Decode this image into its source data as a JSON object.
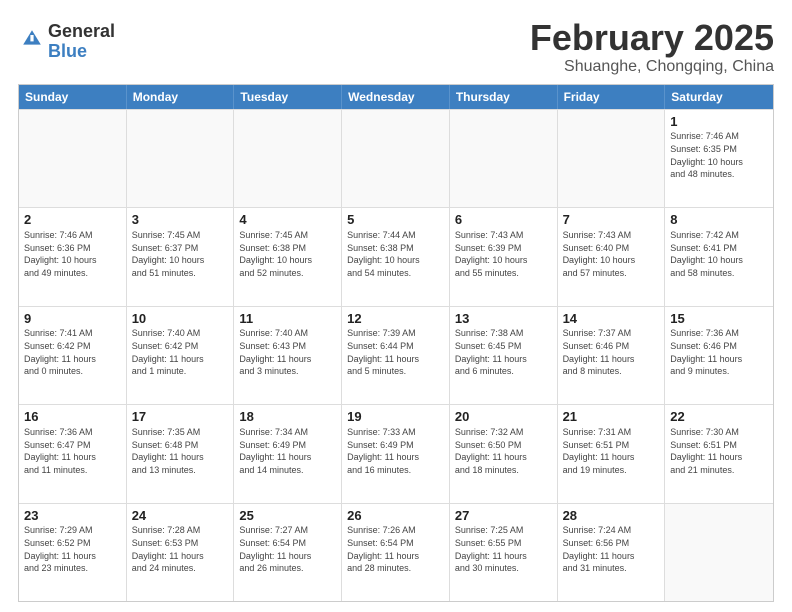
{
  "logo": {
    "general": "General",
    "blue": "Blue"
  },
  "header": {
    "month": "February 2025",
    "location": "Shuanghe, Chongqing, China"
  },
  "dayHeaders": [
    "Sunday",
    "Monday",
    "Tuesday",
    "Wednesday",
    "Thursday",
    "Friday",
    "Saturday"
  ],
  "weeks": [
    [
      {
        "day": "",
        "info": "",
        "empty": true
      },
      {
        "day": "",
        "info": "",
        "empty": true
      },
      {
        "day": "",
        "info": "",
        "empty": true
      },
      {
        "day": "",
        "info": "",
        "empty": true
      },
      {
        "day": "",
        "info": "",
        "empty": true
      },
      {
        "day": "",
        "info": "",
        "empty": true
      },
      {
        "day": "1",
        "info": "Sunrise: 7:46 AM\nSunset: 6:35 PM\nDaylight: 10 hours\nand 48 minutes.",
        "empty": false
      }
    ],
    [
      {
        "day": "2",
        "info": "Sunrise: 7:46 AM\nSunset: 6:36 PM\nDaylight: 10 hours\nand 49 minutes.",
        "empty": false
      },
      {
        "day": "3",
        "info": "Sunrise: 7:45 AM\nSunset: 6:37 PM\nDaylight: 10 hours\nand 51 minutes.",
        "empty": false
      },
      {
        "day": "4",
        "info": "Sunrise: 7:45 AM\nSunset: 6:38 PM\nDaylight: 10 hours\nand 52 minutes.",
        "empty": false
      },
      {
        "day": "5",
        "info": "Sunrise: 7:44 AM\nSunset: 6:38 PM\nDaylight: 10 hours\nand 54 minutes.",
        "empty": false
      },
      {
        "day": "6",
        "info": "Sunrise: 7:43 AM\nSunset: 6:39 PM\nDaylight: 10 hours\nand 55 minutes.",
        "empty": false
      },
      {
        "day": "7",
        "info": "Sunrise: 7:43 AM\nSunset: 6:40 PM\nDaylight: 10 hours\nand 57 minutes.",
        "empty": false
      },
      {
        "day": "8",
        "info": "Sunrise: 7:42 AM\nSunset: 6:41 PM\nDaylight: 10 hours\nand 58 minutes.",
        "empty": false
      }
    ],
    [
      {
        "day": "9",
        "info": "Sunrise: 7:41 AM\nSunset: 6:42 PM\nDaylight: 11 hours\nand 0 minutes.",
        "empty": false
      },
      {
        "day": "10",
        "info": "Sunrise: 7:40 AM\nSunset: 6:42 PM\nDaylight: 11 hours\nand 1 minute.",
        "empty": false
      },
      {
        "day": "11",
        "info": "Sunrise: 7:40 AM\nSunset: 6:43 PM\nDaylight: 11 hours\nand 3 minutes.",
        "empty": false
      },
      {
        "day": "12",
        "info": "Sunrise: 7:39 AM\nSunset: 6:44 PM\nDaylight: 11 hours\nand 5 minutes.",
        "empty": false
      },
      {
        "day": "13",
        "info": "Sunrise: 7:38 AM\nSunset: 6:45 PM\nDaylight: 11 hours\nand 6 minutes.",
        "empty": false
      },
      {
        "day": "14",
        "info": "Sunrise: 7:37 AM\nSunset: 6:46 PM\nDaylight: 11 hours\nand 8 minutes.",
        "empty": false
      },
      {
        "day": "15",
        "info": "Sunrise: 7:36 AM\nSunset: 6:46 PM\nDaylight: 11 hours\nand 9 minutes.",
        "empty": false
      }
    ],
    [
      {
        "day": "16",
        "info": "Sunrise: 7:36 AM\nSunset: 6:47 PM\nDaylight: 11 hours\nand 11 minutes.",
        "empty": false
      },
      {
        "day": "17",
        "info": "Sunrise: 7:35 AM\nSunset: 6:48 PM\nDaylight: 11 hours\nand 13 minutes.",
        "empty": false
      },
      {
        "day": "18",
        "info": "Sunrise: 7:34 AM\nSunset: 6:49 PM\nDaylight: 11 hours\nand 14 minutes.",
        "empty": false
      },
      {
        "day": "19",
        "info": "Sunrise: 7:33 AM\nSunset: 6:49 PM\nDaylight: 11 hours\nand 16 minutes.",
        "empty": false
      },
      {
        "day": "20",
        "info": "Sunrise: 7:32 AM\nSunset: 6:50 PM\nDaylight: 11 hours\nand 18 minutes.",
        "empty": false
      },
      {
        "day": "21",
        "info": "Sunrise: 7:31 AM\nSunset: 6:51 PM\nDaylight: 11 hours\nand 19 minutes.",
        "empty": false
      },
      {
        "day": "22",
        "info": "Sunrise: 7:30 AM\nSunset: 6:51 PM\nDaylight: 11 hours\nand 21 minutes.",
        "empty": false
      }
    ],
    [
      {
        "day": "23",
        "info": "Sunrise: 7:29 AM\nSunset: 6:52 PM\nDaylight: 11 hours\nand 23 minutes.",
        "empty": false
      },
      {
        "day": "24",
        "info": "Sunrise: 7:28 AM\nSunset: 6:53 PM\nDaylight: 11 hours\nand 24 minutes.",
        "empty": false
      },
      {
        "day": "25",
        "info": "Sunrise: 7:27 AM\nSunset: 6:54 PM\nDaylight: 11 hours\nand 26 minutes.",
        "empty": false
      },
      {
        "day": "26",
        "info": "Sunrise: 7:26 AM\nSunset: 6:54 PM\nDaylight: 11 hours\nand 28 minutes.",
        "empty": false
      },
      {
        "day": "27",
        "info": "Sunrise: 7:25 AM\nSunset: 6:55 PM\nDaylight: 11 hours\nand 30 minutes.",
        "empty": false
      },
      {
        "day": "28",
        "info": "Sunrise: 7:24 AM\nSunset: 6:56 PM\nDaylight: 11 hours\nand 31 minutes.",
        "empty": false
      },
      {
        "day": "",
        "info": "",
        "empty": true
      }
    ]
  ]
}
